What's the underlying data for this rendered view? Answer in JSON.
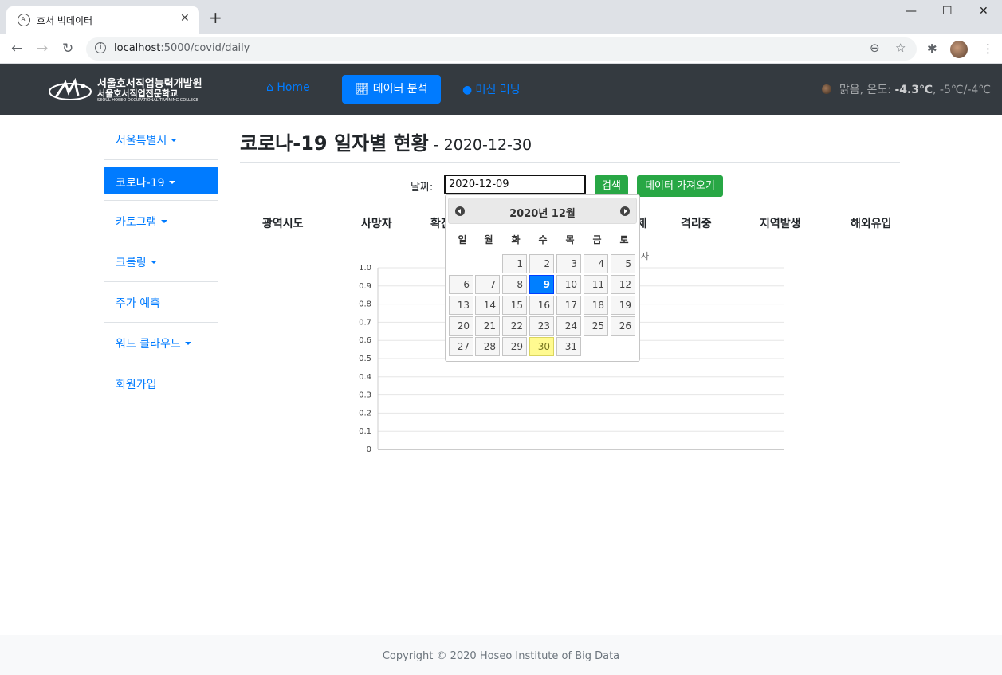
{
  "browser": {
    "tab_title": "호서 빅데이터",
    "url_host": "localhost",
    "url_path": ":5000/covid/daily"
  },
  "navbar": {
    "logo_line1": "서울호서직업능력개발원",
    "logo_line2": "서울호서직업전문학교",
    "logo_line3": "SEOUL HOSEO OCCUPATIONAL TRAINING COLLEGE",
    "home": "Home",
    "data_analysis": "데이터 분석",
    "machine_learning": "머신 러닝",
    "weather_prefix": "맑음, 온도: ",
    "weather_temp": "-4.3℃",
    "weather_range": ", -5℃/-4℃",
    "accent_color": "#007bff",
    "bg_color": "#343a40"
  },
  "sidebar": {
    "items": [
      {
        "label": "서울특별시",
        "dropdown": true
      },
      {
        "label": "코로나-19",
        "dropdown": true,
        "active": true
      },
      {
        "label": "카토그램",
        "dropdown": true
      },
      {
        "label": "크롤링",
        "dropdown": true
      },
      {
        "label": "주가 예측",
        "dropdown": false
      },
      {
        "label": "워드 클라우드",
        "dropdown": true
      },
      {
        "label": "회원가입",
        "dropdown": false
      }
    ]
  },
  "main": {
    "title": "코로나-19 일자별 현황",
    "subtitle": " - 2020-12-30",
    "date_label": "날짜:",
    "date_value": "2020-12-09",
    "search_button": "검색",
    "fetch_button": "데이터 가져오기",
    "table_headers": [
      "광역시도",
      "사망자",
      "확진",
      "격리해제",
      "격리중",
      "지역발생",
      "해외유입"
    ],
    "chart_legend_fragment": "자"
  },
  "chart_data": {
    "type": "bar",
    "categories": [],
    "series": [],
    "yticks": [
      "0",
      "0.1",
      "0.2",
      "0.3",
      "0.4",
      "0.5",
      "0.6",
      "0.7",
      "0.8",
      "0.9",
      "1.0"
    ],
    "ylim": [
      0,
      1
    ],
    "grid": true
  },
  "datepicker": {
    "title": "2020년 12월",
    "weekdays": [
      "일",
      "월",
      "화",
      "수",
      "목",
      "금",
      "토"
    ],
    "first_weekday_index": 2,
    "days_in_month": 31,
    "selected_day": 9,
    "today_day": 30
  },
  "footer": {
    "copyright": "Copyright © 2020 Hoseo Institute of Big Data"
  }
}
